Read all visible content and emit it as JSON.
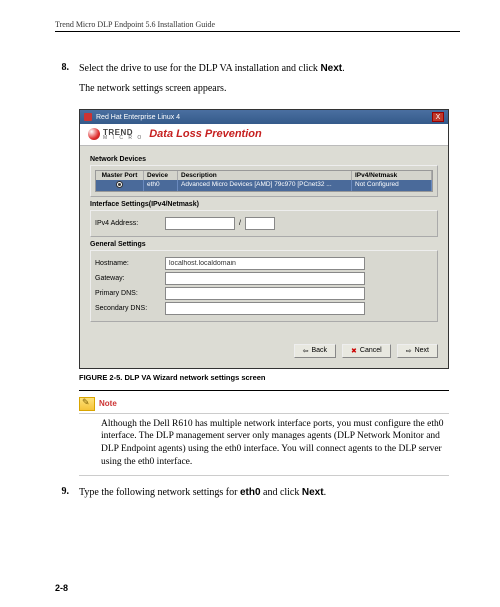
{
  "running_head": "Trend Micro DLP Endpoint 5.6 Installation Guide",
  "step8": {
    "num": "8.",
    "line1_a": "Select the drive to use for the DLP VA installation and click ",
    "line1_b": "Next",
    "line1_c": ".",
    "line2": "The network settings screen appears."
  },
  "shot": {
    "window_title": "Red Hat Enterprise Linux 4",
    "close": "X",
    "brand": {
      "name": "TREND",
      "sub": "M I C R O"
    },
    "dlp_title": "Data Loss Prevention",
    "network_devices_h": "Network Devices",
    "table": {
      "col_mp": "Master Port",
      "col_dev": "Device",
      "col_desc": "Description",
      "col_ip": "IPv4/Netmask",
      "row": {
        "dev": "eth0",
        "desc": "Advanced Micro Devices [AMD] 79c970 [PCnet32 ...",
        "ip": "Not Configured"
      }
    },
    "iface_h": "Interface Settings(IPv4/Netmask)",
    "ipv4_label": "IPv4 Address:",
    "ipv4_addr": "",
    "slash": "/",
    "netmask": "",
    "general_h": "General Settings",
    "hostname_label": "Hostname:",
    "hostname": "localhost.localdomain",
    "gateway_label": "Gateway:",
    "gateway": "",
    "pdns_label": "Primary DNS:",
    "pdns": "",
    "sdns_label": "Secondary DNS:",
    "sdns": "",
    "buttons": {
      "back": "Back",
      "cancel": "Cancel",
      "next": "Next"
    }
  },
  "fig_caption": {
    "label": "FIGURE 2-5. ",
    "text": "DLP VA Wizard network settings screen"
  },
  "note": {
    "label": "Note",
    "body": "Although the Dell R610 has multiple network interface ports, you must configure the eth0 interface. The DLP management server only manages agents (DLP Network Monitor and DLP Endpoint agents) using the eth0 interface. You will connect agents to the DLP server using the eth0 interface."
  },
  "step9": {
    "num": "9.",
    "a": "Type the following network settings for ",
    "b": "eth0",
    "c": " and click ",
    "d": "Next",
    "e": "."
  },
  "page_num": "2-8"
}
